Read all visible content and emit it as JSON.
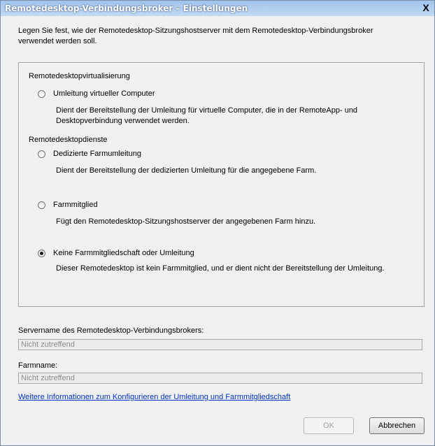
{
  "window": {
    "title": "Remotedesktop-Verbindungsbroker – Einstellungen",
    "close_label": "X"
  },
  "intro": "Legen Sie fest, wie der Remotedesktop-Sitzungshostserver mit dem Remotedesktop-Verbindungsbroker verwendet werden soll.",
  "virtualization": {
    "heading": "Remotedesktopvirtualisierung",
    "option": {
      "label": "Umleitung virtueller Computer",
      "selected": false,
      "description": "Dient der Bereitstellung der Umleitung für virtuelle Computer, die in der RemoteApp- und Desktopverbindung verwendet werden."
    }
  },
  "services": {
    "heading": "Remotedesktopdienste",
    "options": [
      {
        "label": "Dedizierte Farmumleitung",
        "selected": false,
        "description": "Dient der Bereitstellung der dedizierten Umleitung für die angegebene Farm."
      },
      {
        "label": "Farmmitglied",
        "selected": false,
        "description": "Fügt den Remotedesktop-Sitzungshostserver der angegebenen Farm hinzu."
      },
      {
        "label": "Keine Farmmitgliedschaft oder Umleitung",
        "selected": true,
        "description": "Dieser Remotedesktop ist kein Farmmitglied, und er dient nicht der Bereitstellung der Umleitung."
      }
    ]
  },
  "server_field": {
    "label": "Servername des Remotedesktop-Verbindungsbrokers:",
    "value": "Nicht zutreffend"
  },
  "farm_field": {
    "label": "Farmname:",
    "value": "Nicht zutreffend"
  },
  "link": "Weitere Informationen zum Konfigurieren der Umleitung und Farmmitgliedschaft",
  "buttons": {
    "ok": "OK",
    "cancel": "Abbrechen"
  }
}
